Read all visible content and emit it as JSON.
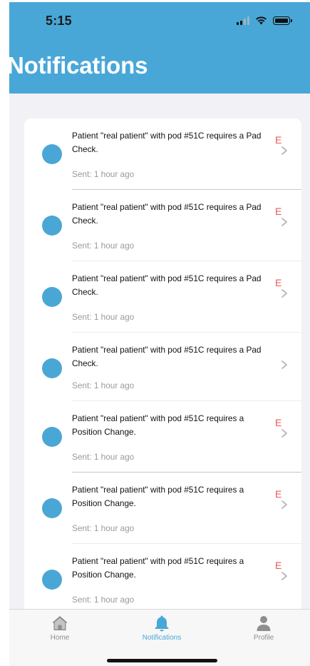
{
  "status_bar": {
    "time": "5:15"
  },
  "header": {
    "title": "Notifications",
    "color": "#48a7d7"
  },
  "notifications": [
    {
      "message": "Patient \"real patient\" with pod #51C requires a Pad Check.",
      "sent": "Sent: 1 hour ago",
      "badge": "E"
    },
    {
      "message": "Patient \"real patient\" with pod #51C requires a Pad Check.",
      "sent": "Sent: 1 hour ago",
      "badge": "E"
    },
    {
      "message": "Patient \"real patient\" with pod #51C requires a Pad Check.",
      "sent": "Sent: 1 hour ago",
      "badge": "E"
    },
    {
      "message": "Patient \"real patient\" with pod #51C requires a Pad Check.",
      "sent": "Sent: 1 hour ago",
      "badge": ""
    },
    {
      "message": "Patient \"real patient\" with pod #51C requires a Position Change.",
      "sent": "Sent: 1 hour ago",
      "badge": "E"
    },
    {
      "message": "Patient \"real patient\" with pod #51C requires a Position Change.",
      "sent": "Sent: 1 hour ago",
      "badge": "E"
    },
    {
      "message": "Patient \"real patient\" with pod #51C requires a Position Change.",
      "sent": "Sent: 1 hour ago",
      "badge": "E"
    }
  ],
  "tabs": [
    {
      "label": "Home",
      "icon": "home-icon",
      "active": false
    },
    {
      "label": "Notifications",
      "icon": "bell-icon",
      "active": true
    },
    {
      "label": "Profile",
      "icon": "person-icon",
      "active": false
    }
  ],
  "colors": {
    "accent": "#48a7d7",
    "badge": "#e85a5a",
    "dot": "#4aa7d5"
  }
}
